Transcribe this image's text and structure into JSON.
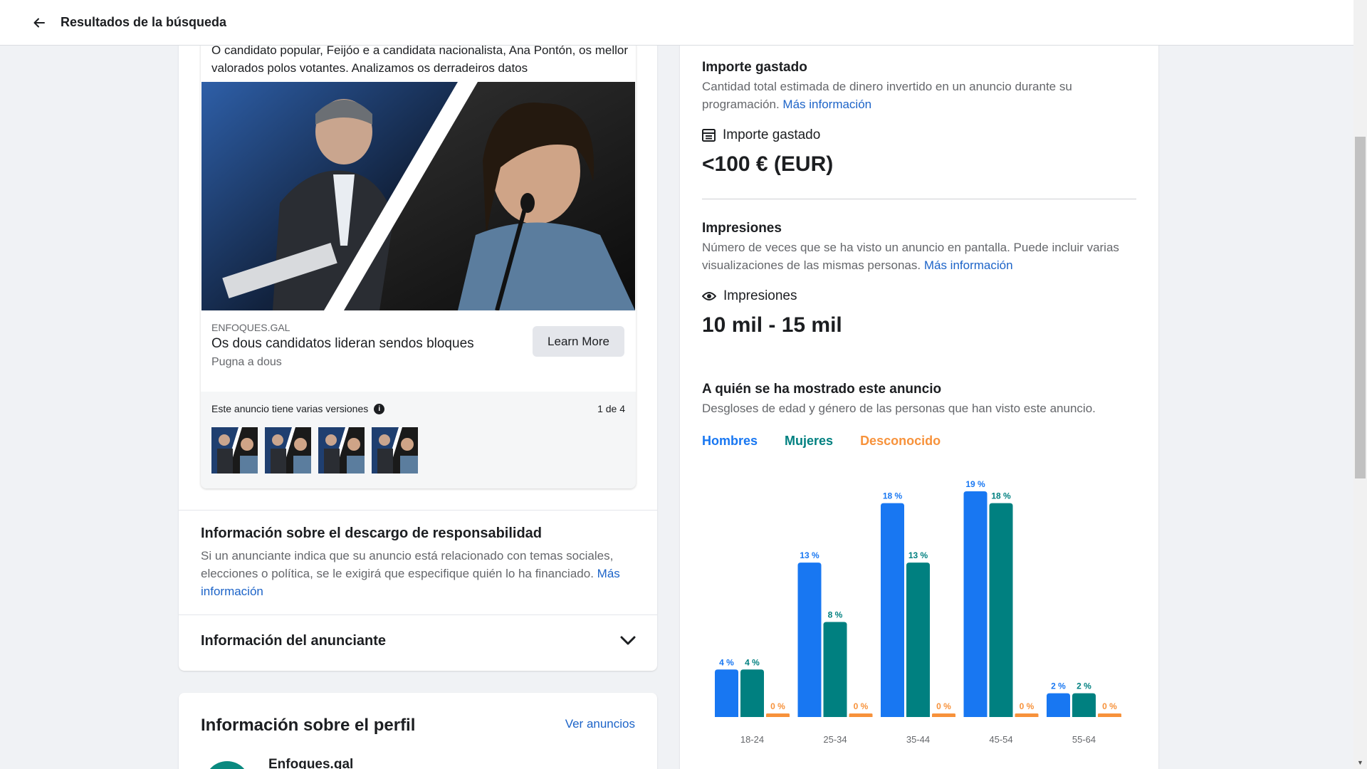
{
  "header": {
    "title": "Resultados de la búsqueda",
    "back_icon": "arrow-left-icon"
  },
  "ad": {
    "body_text": "O candidato popular, Feijóo e a candidata nacionalista, Ana Pontón, os mellor valorados polos votantes. Analizamos os derradeiros datos",
    "domain": "ENFOQUES.GAL",
    "headline": "Os dous candidatos lideran sendos bloques",
    "description": "Pugna a dous",
    "cta": "Learn More",
    "versions_label": "Este anuncio tiene varias versiones",
    "versions_count": "1 de 4"
  },
  "disclaimer": {
    "title": "Información sobre el descargo de responsabilidad",
    "text": "Si un anunciante indica que su anuncio está relacionado con temas sociales, elecciones o política, se le exigirá que especifique quién lo ha financiado.",
    "link": "Más información"
  },
  "advertiser": {
    "title": "Información del anunciante"
  },
  "profile": {
    "title": "Información sobre el perfil",
    "link": "Ver anuncios",
    "name": "Enfoques.gal"
  },
  "spend": {
    "title": "Importe gastado",
    "desc": "Cantidad total estimada de dinero invertido en un anuncio durante su programación.",
    "link": "Más información",
    "label": "Importe gastado",
    "value": "<100 € (EUR)"
  },
  "impressions": {
    "title": "Impresiones",
    "desc": "Número de veces que se ha visto un anuncio en pantalla. Puede incluir varias visualizaciones de las mismas personas.",
    "link": "Más información",
    "label": "Impresiones",
    "value": "10 mil - 15 mil"
  },
  "audience": {
    "title": "A quién se ha mostrado este anuncio",
    "desc": "Desgloses de edad y género de las personas que han visto este anuncio."
  },
  "colors": {
    "men": "#1877f2",
    "women": "#008080",
    "unknown": "#f7923b",
    "link": "#1d64c8"
  },
  "chart_data": {
    "type": "bar",
    "categories": [
      "18-24",
      "25-34",
      "35-44",
      "45-54",
      "55-64"
    ],
    "series": [
      {
        "name": "Hombres",
        "values": [
          4,
          13,
          18,
          19,
          2
        ],
        "labels": [
          "4 %",
          "13 %",
          "18 %",
          "19 %",
          "2 %"
        ]
      },
      {
        "name": "Mujeres",
        "values": [
          4,
          8,
          13,
          18,
          2
        ],
        "labels": [
          "4 %",
          "8 %",
          "13 %",
          "18 %",
          "2 %"
        ]
      },
      {
        "name": "Desconocido",
        "values": [
          0,
          0,
          0,
          0,
          0
        ],
        "labels": [
          "0 %",
          "0 %",
          "0 %",
          "0 %",
          "0 %"
        ]
      }
    ],
    "ylim": [
      0,
      19
    ],
    "legend": "top-left",
    "grid": false
  }
}
